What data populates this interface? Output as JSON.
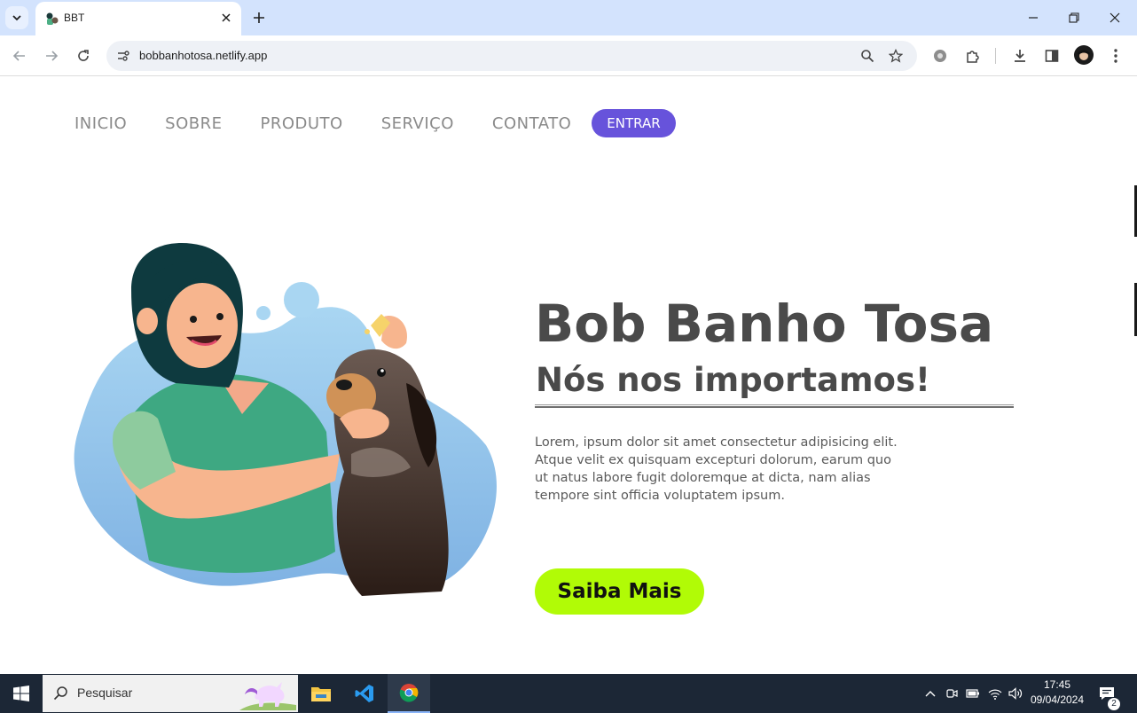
{
  "browser": {
    "tab": {
      "title": "BBT"
    },
    "url": "bobbanhotosa.netlify.app"
  },
  "site": {
    "nav": {
      "items": [
        "INICIO",
        "SOBRE",
        "PRODUTO",
        "SERVIÇO",
        "CONTATO"
      ],
      "cta": "ENTRAR"
    },
    "hero": {
      "title": "Bob Banho Tosa",
      "subtitle": "Nós nos importamos!",
      "text": "Lorem, ipsum dolor sit amet consectetur adipisicing elit. Atque velit ex quisquam excepturi dolorum, earum quo ut natus labore fugit doloremque at dicta, nam alias tempore sint officia voluptatem ipsum.",
      "button": "Saiba Mais"
    },
    "colors": {
      "cta": "#6753db",
      "button": "#b1fb06",
      "heading": "#4a4a4a"
    }
  },
  "taskbar": {
    "search_placeholder": "Pesquisar",
    "time": "17:45",
    "date": "09/04/2024",
    "notifications": "2"
  }
}
